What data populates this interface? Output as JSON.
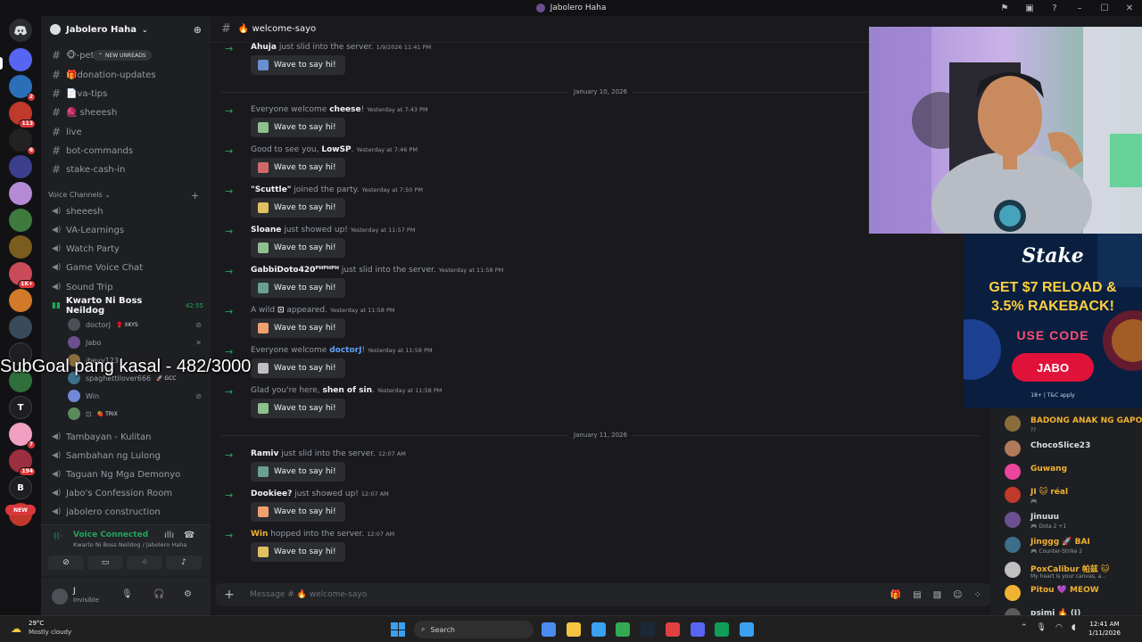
{
  "window": {
    "title": "Jabolero Haha"
  },
  "rail": {
    "servers": [
      {
        "letter": "",
        "color": "#5865f2",
        "badge": ""
      },
      {
        "letter": "",
        "color": "#2a6fb8",
        "badge": "2"
      },
      {
        "letter": "",
        "color": "#c0392b",
        "badge": "113"
      },
      {
        "letter": "",
        "color": "#222",
        "badge": "6"
      },
      {
        "letter": "",
        "color": "#3b3f8c",
        "badge": ""
      },
      {
        "letter": "",
        "color": "#b48ad6",
        "badge": ""
      },
      {
        "letter": "",
        "color": "#3e7a3e",
        "badge": ""
      },
      {
        "letter": "",
        "color": "#7a5c1e",
        "badge": ""
      },
      {
        "letter": "",
        "color": "#c94b5a",
        "badge": "1K+"
      },
      {
        "letter": "",
        "color": "#d17a2a",
        "badge": ""
      },
      {
        "letter": "",
        "color": "#394a5a",
        "badge": ""
      },
      {
        "letter": "",
        "color": "#1e1f22",
        "badge": ""
      },
      {
        "letter": "",
        "color": "#2f6f3b",
        "badge": ""
      },
      {
        "letter": "T",
        "color": "#1e1f22",
        "badge": ""
      },
      {
        "letter": "",
        "color": "#f0a0c0",
        "badge": "7"
      },
      {
        "letter": "",
        "color": "#9c2f3f",
        "badge": "194"
      },
      {
        "letter": "B",
        "color": "#1e1f22",
        "badge": ""
      },
      {
        "letter": "",
        "color": "#c0392b",
        "badge": ""
      }
    ],
    "new_label": "NEW"
  },
  "sidebar": {
    "guild_name": "Jabolero Haha",
    "new_unreads": "NEW UNREADS",
    "text_channels": [
      {
        "name": "🐵-pet"
      },
      {
        "name": "🎁donation-updates"
      },
      {
        "name": "📄va-tips"
      },
      {
        "name": "🧶 sheeesh"
      },
      {
        "name": "live"
      },
      {
        "name": "bot-commands"
      },
      {
        "name": "stake-cash-in"
      }
    ],
    "voice_category": "Voice Channels",
    "voice_channels": [
      {
        "name": "sheeesh"
      },
      {
        "name": "VA-Learnings"
      },
      {
        "name": "Watch Party"
      },
      {
        "name": "Game Voice Chat"
      },
      {
        "name": "Sound Trip"
      }
    ],
    "active_voice": {
      "name": "Kwarto Ni Boss Neildog",
      "time": "42:55"
    },
    "voice_users": [
      {
        "name": "doctorJ",
        "tag": "🥊 XKYS",
        "color": "#4e5058"
      },
      {
        "name": "Jabo",
        "tag": "",
        "color": "#6b4f8f"
      },
      {
        "name": "jheyy123",
        "tag": "",
        "color": "#8a6d3b"
      },
      {
        "name": "spaghettilover666",
        "tag": "🚀 GCC",
        "color": "#3b6f8a"
      },
      {
        "name": "Win",
        "tag": "",
        "color": "#7289da"
      },
      {
        "name": "⊡",
        "tag": "🍓 TRIX",
        "color": "#5a8a5a"
      }
    ],
    "more_channels": [
      {
        "name": "Tambayan - Kulitan"
      },
      {
        "name": "Sambahan ng Lulong"
      },
      {
        "name": "Taguan Ng Mga Demonyo"
      },
      {
        "name": "Jabo's Confession Room"
      },
      {
        "name": "jabolero construction"
      }
    ],
    "voice_status": {
      "title": "Voice Connected",
      "subtitle": "Kwarto Ni Boss Neildog / Jabolero Haha"
    },
    "user": {
      "name": "J",
      "status": "Invisible"
    }
  },
  "chat": {
    "channel": "🔥 welcome-sayo",
    "wave_label": "Wave to say hi!",
    "placeholder": "Message # 🔥 welcome-sayo",
    "messages": [
      {
        "pre": "",
        "name": "Ahuja",
        "post": " just slid into the server.",
        "time": "1/9/2026 11:41 PM",
        "sticker": "#6a8fd0"
      },
      {
        "pre": "Everyone welcome ",
        "name": "cheese",
        "post": "!",
        "time": "Yesterday at 7:43 PM",
        "sticker": "#8fc08f"
      },
      {
        "pre": "Good to see you, ",
        "name": "LowSP",
        "post": ".",
        "time": "Yesterday at 7:46 PM",
        "sticker": "#d06a6a"
      },
      {
        "pre": "",
        "name": "\"Scuttle\"",
        "post": " joined the party.",
        "time": "Yesterday at 7:50 PM",
        "sticker": "#e0c060"
      },
      {
        "pre": "",
        "name": "Sloane",
        "post": " just showed up!",
        "time": "Yesterday at 11:57 PM",
        "sticker": "#8fc08f"
      },
      {
        "pre": "",
        "name": "GabbiDoto420ᴾᴴᴾᴴᴾᴴ",
        "post": " just slid into the server.",
        "time": "Yesterday at 11:58 PM",
        "sticker": "#6aa08f"
      },
      {
        "pre": "A wild ",
        "name": "⊡",
        "post": " appeared.",
        "time": "Yesterday at 11:58 PM",
        "sticker": "#f0a070"
      },
      {
        "pre": "Everyone welcome ",
        "name": "doctorJ",
        "post": "!",
        "time": "Yesterday at 11:58 PM",
        "sticker": "#c0c0c0"
      },
      {
        "pre": "Glad you're here, ",
        "name": "shen of sin",
        "post": ".",
        "time": "Yesterday at 11:58 PM",
        "sticker": "#8fc08f"
      },
      {
        "pre": "",
        "name": "Ramiv",
        "post": " just slid into the server.",
        "time": "12:07 AM",
        "sticker": "#6aa08f"
      },
      {
        "pre": "",
        "name": "Dookiee?",
        "post": " just showed up!",
        "time": "12:07 AM",
        "sticker": "#f0a070"
      },
      {
        "pre": "",
        "name": "Win",
        "post": " hopped into the server.",
        "time": "12:07 AM",
        "sticker": "#e0c060"
      }
    ],
    "dividers": [
      "January 10, 2026",
      "January 11, 2026"
    ]
  },
  "overlay": {
    "text": "SubGoal pang kasal - 482/3000"
  },
  "ad": {
    "logo": "Stake",
    "headline_1": "GET $7 RELOAD &",
    "headline_2": "3.5% RAKEBACK!",
    "use_code": "USE CODE",
    "code": "JABO",
    "fine": "18+ | T&C apply"
  },
  "members": [
    {
      "name": "BADONG ANAK NG GAPO",
      "sub": "??",
      "color": "#f0b232",
      "av": "#8a6d3b"
    },
    {
      "name": "ChocoSlice23",
      "sub": "",
      "color": "#dbdee1",
      "av": "#b07a5a"
    },
    {
      "name": "Guwang",
      "sub": "",
      "color": "#f0b232",
      "av": "#eb459e"
    },
    {
      "name": "JI 🐱 réal",
      "sub": "🎮",
      "color": "#f0b232",
      "av": "#c0392b"
    },
    {
      "name": "Jinuuu",
      "sub": "🎮 Dota 2 +1",
      "color": "#dbdee1",
      "av": "#6b4f8f"
    },
    {
      "name": "Jinggg 🚀 BAI",
      "sub": "🎮 Counter-Strike 2",
      "color": "#f0b232",
      "av": "#3b6f8a"
    },
    {
      "name": "PoxCalibur 帕兹 🐱",
      "sub": "My heart is your canvas, a...",
      "color": "#f0b232",
      "av": "#c0c0c0"
    },
    {
      "name": "Pitou 💜 MEOW",
      "sub": "",
      "color": "#f0b232",
      "av": "#f0b232"
    },
    {
      "name": "psimi 🔥 (I)",
      "sub": "",
      "color": "#dbdee1",
      "av": "#5a5a5a"
    }
  ],
  "taskbar": {
    "weather_temp": "29°C",
    "weather_desc": "Mostly cloudy",
    "search": "Search",
    "time": "12:41 AM",
    "date": "1/11/2026",
    "apps": [
      "#4b8bf0",
      "#f5c542",
      "#3aa0f0",
      "#34a853",
      "#1b2838",
      "#e04040",
      "#5865f2",
      "#0f9d58",
      "#3aa0f0"
    ]
  }
}
